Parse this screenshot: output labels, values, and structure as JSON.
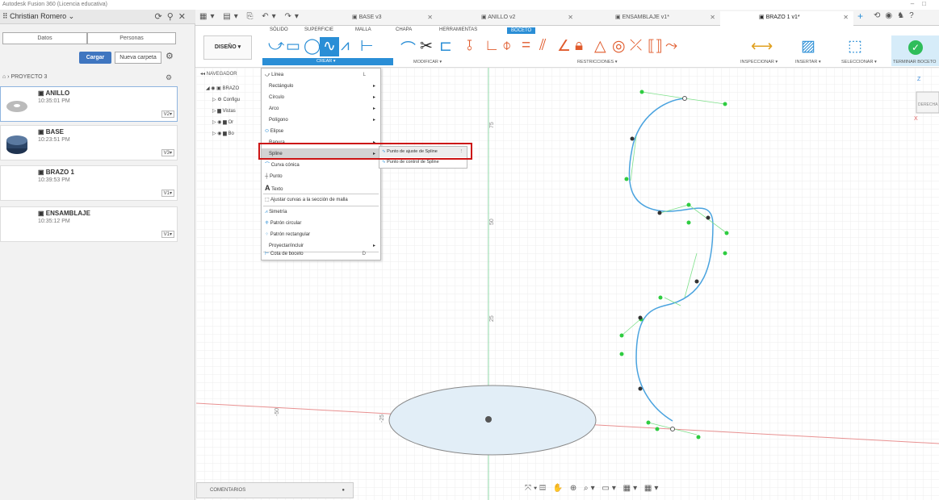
{
  "window": {
    "title": "Autodesk Fusion 360 (Licencia educativa)"
  },
  "colors": {
    "accent_blue": "#2a8ed6",
    "button_blue": "#3f76c0",
    "highlight_red": "#cc1414",
    "axis_red": "#e06060",
    "axis_green": "#3cb371",
    "spline_blue": "#4aa3df",
    "handle_green": "#2ecc40",
    "ellipse_fill": "#e2eef7"
  },
  "data_panel": {
    "user": "Christian Romero",
    "tabs": [
      "Datos",
      "Personas"
    ],
    "upload_label": "Cargar",
    "new_folder_label": "Nueva carpeta",
    "breadcrumb": "PROYECTO 3",
    "files": [
      {
        "name": "ANILLO",
        "time": "10:35:01 PM",
        "version": "V2"
      },
      {
        "name": "BASE",
        "time": "10:23:51 PM",
        "version": "V3"
      },
      {
        "name": "BRAZO 1",
        "time": "10:39:53 PM",
        "version": "V1"
      },
      {
        "name": "ENSAMBLAJE",
        "time": "10:35:12 PM",
        "version": "V1"
      }
    ]
  },
  "doc_tabs": [
    {
      "label": "BASE v3"
    },
    {
      "label": "ANILLO v2"
    },
    {
      "label": "ENSAMBLAJE v1*"
    },
    {
      "label": "BRAZO 1 v1*"
    }
  ],
  "ribbon": {
    "tabs": [
      "SÓLIDO",
      "SUPERFICIE",
      "MALLA",
      "CHAPA",
      "HERRAMIENTAS",
      "BOCETO"
    ],
    "active_tab": "BOCETO",
    "workspace": "DISEÑO",
    "groups": [
      "CREAR",
      "MODIFICAR",
      "RESTRICCIONES",
      "INSPECCIONAR",
      "INSERTAR",
      "SELECCIONAR",
      "TERMINAR BOCETO"
    ]
  },
  "browser": {
    "title": "NAVEGADOR",
    "rows": [
      "BRAZO",
      "Configu",
      "Vistas",
      "Or",
      "Bo"
    ]
  },
  "create_menu": {
    "items": [
      {
        "label": "Línea",
        "shortcut": "L"
      },
      {
        "label": "Rectángulo",
        "arrow": "▸"
      },
      {
        "label": "Círculo",
        "arrow": "▸"
      },
      {
        "label": "Arco",
        "arrow": "▸"
      },
      {
        "label": "Polígono",
        "arrow": "▸"
      },
      {
        "label": "Elipse"
      },
      {
        "label": "Ranura",
        "arrow": "▸"
      },
      {
        "label": "Spline",
        "arrow": "▸"
      },
      {
        "label": "Curva cónica"
      },
      {
        "label": "Punto"
      },
      {
        "label": "Texto"
      },
      {
        "label": "Ajustar curvas a la sección de malla"
      },
      {
        "label": "Simetría"
      },
      {
        "label": "Patrón circular"
      },
      {
        "label": "Patrón rectangular"
      },
      {
        "label": "Proyectar/incluir",
        "arrow": "▸"
      },
      {
        "label": "Cota de boceto",
        "shortcut": "D"
      }
    ]
  },
  "spline_submenu": {
    "items": [
      "Punto de ajuste de Spline",
      "Punto de control de Spline"
    ]
  },
  "axis_labels": [
    "75",
    "50",
    "25",
    "-50",
    "-25"
  ],
  "viewcube": {
    "label": "DERECHA",
    "axis_z": "Z",
    "axis_x": "X"
  },
  "comments_label": "COMENTARIOS"
}
